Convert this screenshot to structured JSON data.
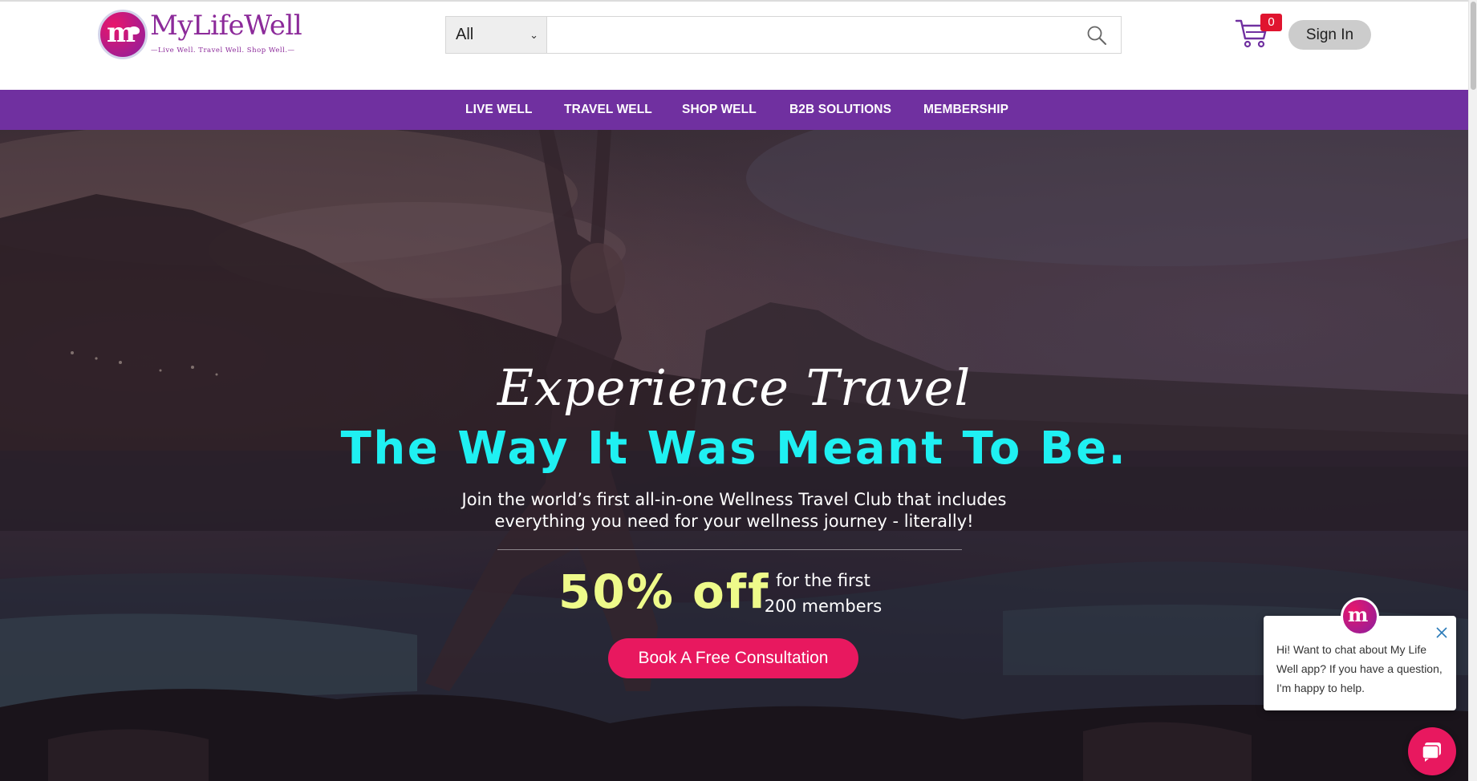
{
  "brand": {
    "name": "MyLifeWell",
    "tagline": "—Live Well. Travel Well. Shop Well.—",
    "logo_initials": "m"
  },
  "header": {
    "search": {
      "category_selected": "All",
      "placeholder": "",
      "value": "",
      "icon": "search-icon"
    },
    "cart": {
      "icon": "cart-icon",
      "count": "0"
    },
    "signin_label": "Sign In"
  },
  "nav": {
    "items": [
      {
        "label": "LIVE WELL"
      },
      {
        "label": "TRAVEL WELL"
      },
      {
        "label": "SHOP WELL"
      },
      {
        "label": "B2B SOLUTIONS"
      },
      {
        "label": "MEMBERSHIP"
      }
    ]
  },
  "hero": {
    "script_title": "Experience Travel",
    "headline": "The Way It Was Meant To Be.",
    "subtitle_line1": "Join the world’s first all-in-one Wellness Travel Club that includes",
    "subtitle_line2": "everything you need for your wellness journey - literally!",
    "offer": "50% off",
    "offer_note_line1": "for the first",
    "offer_note_line2": "200 members",
    "cta_label": "Book A Free Consultation"
  },
  "chat": {
    "message": "Hi! Want to chat about My Life Well app? If you have a question, I'm happy to help.",
    "avatar_initials": "m",
    "close_icon": "close-icon",
    "launcher_icon": "chat-icon"
  },
  "colors": {
    "nav_bg": "#7030a0",
    "brand_purple": "#8c2a9a",
    "cta_pink": "#e8185f",
    "headline_cyan": "#1ff0f2",
    "offer_yellow": "#eefa8a",
    "badge_red": "#e0142f"
  }
}
